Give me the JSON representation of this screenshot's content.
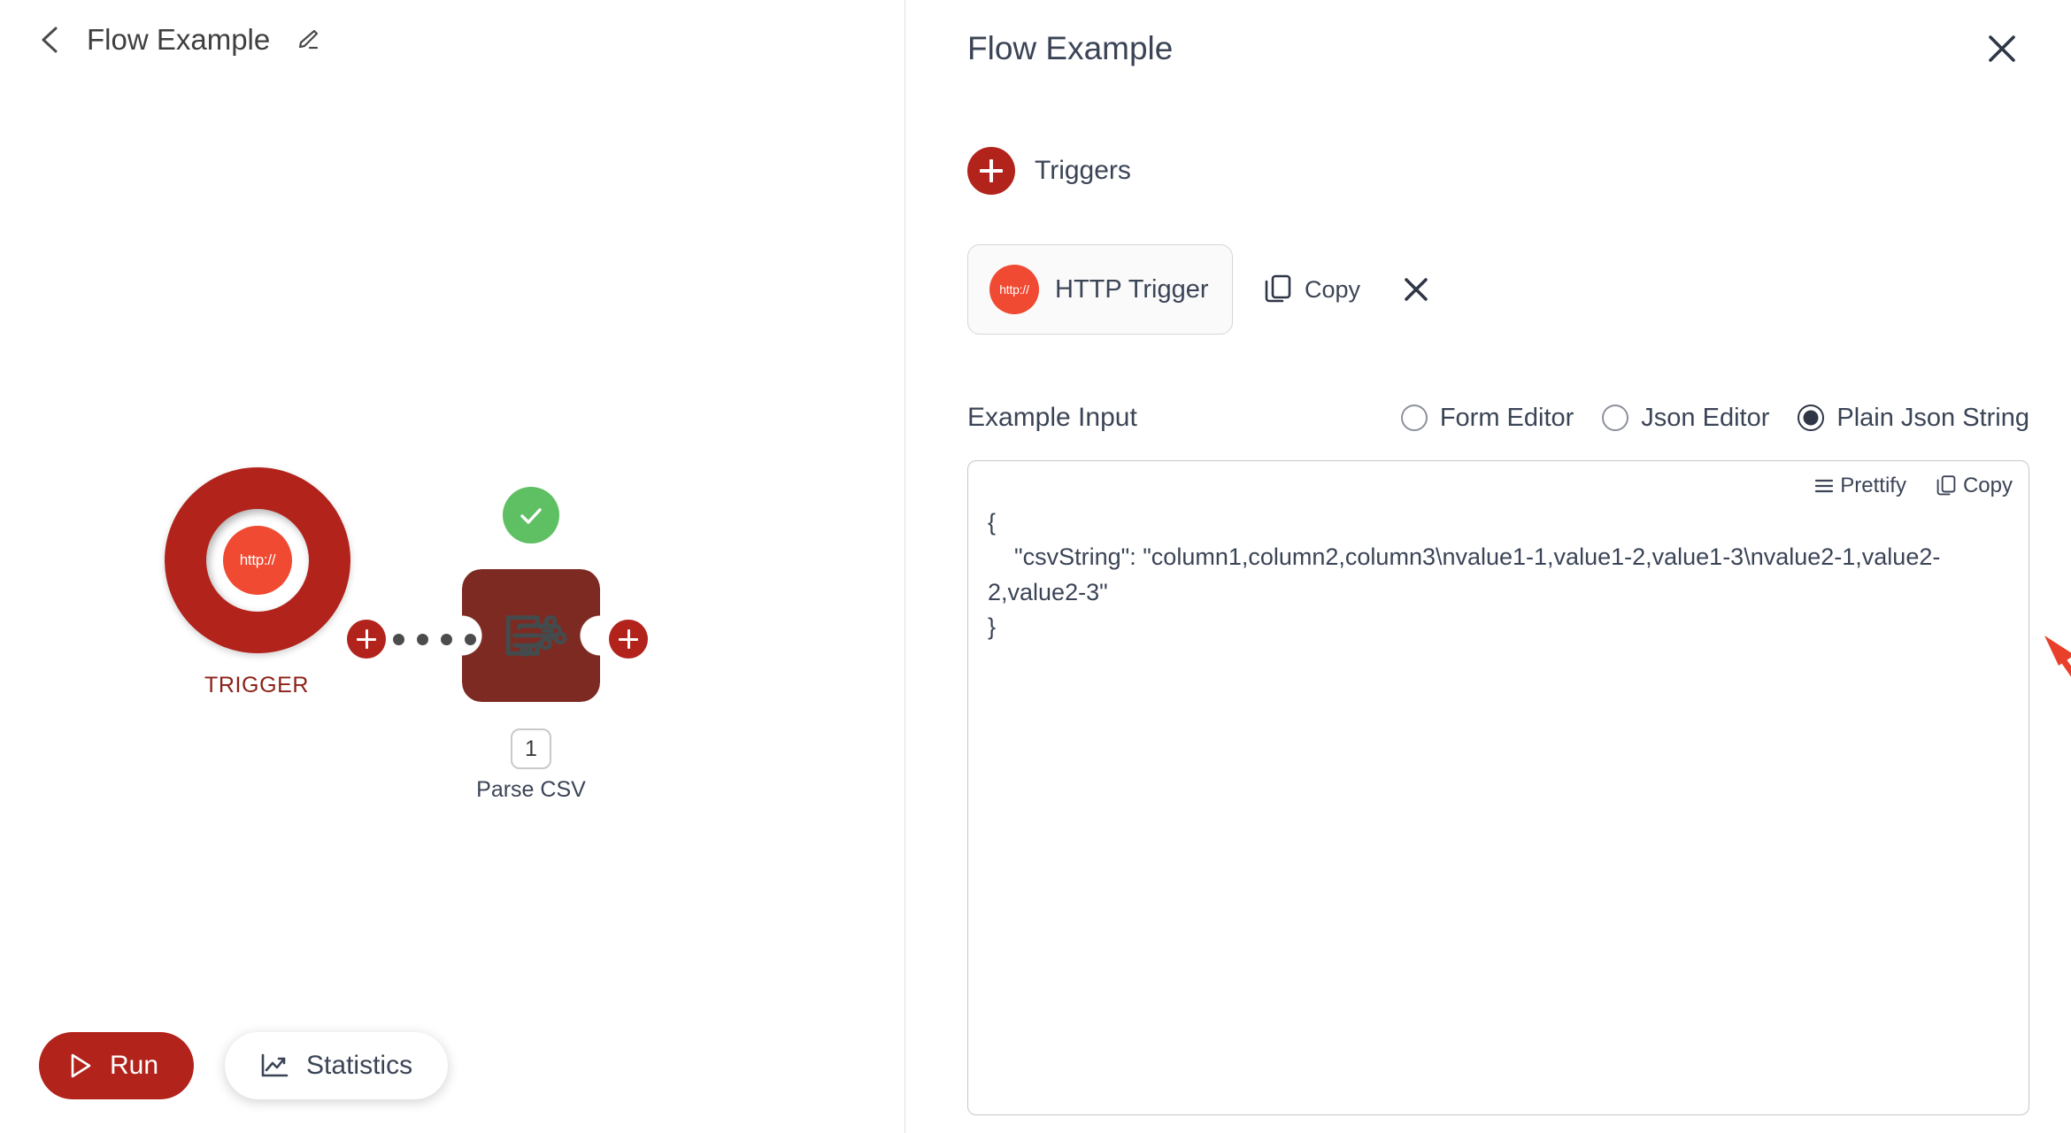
{
  "left": {
    "header": {
      "back_icon": "chevron-left-icon",
      "title": "Flow Example",
      "edit_icon": "pencil-edit-icon"
    },
    "canvas": {
      "trigger_node": {
        "icon_label": "http://",
        "label": "TRIGGER",
        "ring_color": "#b2231c",
        "inner_color": "#f04a32"
      },
      "connector": {
        "dot_count": 4,
        "add_step_icon": "plus-icon"
      },
      "action_node": {
        "label": "Parse CSV",
        "step_number": "1",
        "status": "success",
        "status_icon": "check-icon",
        "body_color": "#7d2a22",
        "status_color": "#5fbf63",
        "icon": "circuit-board-icon"
      }
    },
    "bottom": {
      "run_label": "Run",
      "run_icon": "play-icon",
      "run_color": "#b2231c",
      "statistics_label": "Statistics",
      "statistics_icon": "line-chart-icon"
    }
  },
  "right": {
    "title": "Flow Example",
    "close_icon": "close-icon",
    "triggers": {
      "add_icon": "plus-icon",
      "label": "Triggers",
      "card": {
        "badge_text": "http://",
        "name": "HTTP Trigger"
      },
      "copy_label": "Copy",
      "copy_icon": "copy-icon",
      "remove_icon": "close-icon"
    },
    "example_input": {
      "label": "Example Input",
      "options": [
        {
          "label": "Form Editor",
          "checked": false
        },
        {
          "label": "Json Editor",
          "checked": false
        },
        {
          "label": "Plain Json String",
          "checked": true
        }
      ],
      "selected": "Plain Json String"
    },
    "json_editor": {
      "prettify_label": "Prettify",
      "prettify_icon": "list-lines-icon",
      "copy_label": "Copy",
      "copy_icon": "copy-icon",
      "value": "{\n    \"csvString\": \"column1,column2,column3\\nvalue1-1,value1-2,value1-3\\nvalue2-1,value2-2,value2-3\"\n}"
    }
  },
  "annotations": {
    "arrow_color": "#e8402a",
    "down_arrow_target": "Plain Json String",
    "diagonal_arrow_target": "csvString value"
  }
}
